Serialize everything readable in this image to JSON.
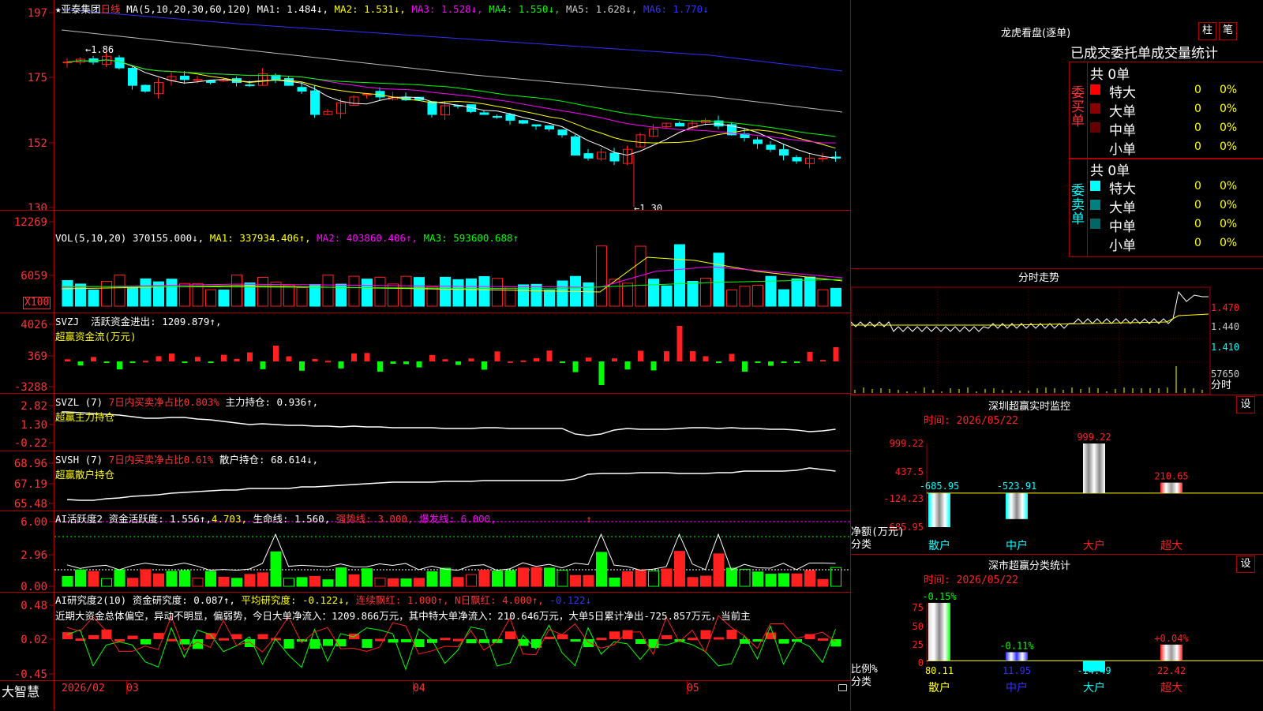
{
  "colors": {
    "up": "#ff2020",
    "down": "#00ffff",
    "bg": "#000000",
    "grid": "#aa0000",
    "yellow": "#ffff00",
    "magenta": "#ff00ff",
    "green": "#00ff00",
    "blue": "#3030ff",
    "white": "#ffffff"
  },
  "main": {
    "header": {
      "star": "★",
      "name": "亚泰集团",
      "period": "日线",
      "ma_label": "MA(5,10,20,30,60,120)",
      "ma1": "MA1: 1.484↓,",
      "ma2": "MA2: 1.531↓,",
      "ma3": "MA3: 1.528↓,",
      "ma4": "MA4: 1.550↓,",
      "ma5": "MA5: 1.628↓,",
      "ma6": "MA6: 1.770↓"
    },
    "yticks": [
      "197",
      "175",
      "152",
      "130"
    ],
    "high_label": "←1.86",
    "low_label": "←1.30"
  },
  "vol": {
    "header": {
      "t1": "VOL(5,10,20)",
      "t2": "370155.000↓,",
      "t3": "MA1: 337934.406↑,",
      "t4": "MA2: 403860.406↑,",
      "t5": "MA3: 593600.688↑"
    },
    "yticks": [
      "12269",
      "6059"
    ],
    "unit": "X100"
  },
  "svzj": {
    "header": {
      "t1": "SVZJ",
      "t2": "活跃资金进出: 1209.879↑,",
      "t3": "超赢资金流(万元)"
    },
    "yticks": [
      "4026",
      "369",
      "-3288"
    ]
  },
  "svzl": {
    "header": {
      "t1": "SVZL (7)",
      "t2": "7日内买卖净占比0.803%",
      "t3": "主力持仓: 0.936↑,",
      "t4": "超赢主力持仓"
    },
    "yticks": [
      "2.82",
      "1.30",
      "-0.22"
    ]
  },
  "svsh": {
    "header": {
      "t1": "SVSH (7)",
      "t2": "7日内买卖净占比0.61%",
      "t3": "散户持仓: 68.614↓,",
      "t4": "超赢散户持仓"
    },
    "yticks": [
      "68.96",
      "67.19",
      "65.48"
    ]
  },
  "ai1": {
    "header": {
      "t1": "AI活跃度2",
      "t2": "资金活跃度: 1.556↑,",
      "t3": "4.703,",
      "t4": "生命线: 1.560,",
      "t5": "强势线: 3.000,",
      "t6": "爆发线: 6.000,",
      "t7": "↑"
    },
    "yticks": [
      "6.00",
      "2.96",
      "0.00"
    ]
  },
  "ai2": {
    "header": {
      "t1": "AI研究度2(10)",
      "t2": "资金研究度: 0.087↑,",
      "t3": "平均研究度: -0.122↓,",
      "t4": "连续飘红: 1.000↑,",
      "t5": "N日飘红: 4.000↑,",
      "t6": "-0.122↓"
    },
    "summary": "近期大资金总体偏空，异动不明显，偏弱势，今日大单净流入：1209.866万元，其中特大单净流入：210.646万元，大单5日累计净出-725.857万元，当前主",
    "yticks": [
      "0.48",
      "0.02",
      "-0.45"
    ]
  },
  "xaxis": {
    "brand": "大智慧",
    "labels": [
      "2026/02",
      "03",
      "04",
      "05"
    ]
  },
  "longhu": {
    "title": "龙虎看盘(逐单)",
    "btn_bar": "柱",
    "btn_pen": "笔",
    "subtitle": "已成交委托单成交量统计",
    "buy": {
      "side": "委买单",
      "total": "共 0单",
      "rows": [
        {
          "label": "特大",
          "value": "0",
          "pct": "0%",
          "color": "#ff0000"
        },
        {
          "label": "大单",
          "value": "0",
          "pct": "0%",
          "color": "#8b0000"
        },
        {
          "label": "中单",
          "value": "0",
          "pct": "0%",
          "color": "#660000"
        },
        {
          "label": "小单",
          "value": "0",
          "pct": "0%",
          "color": "#000000"
        }
      ]
    },
    "sell": {
      "side": "委卖单",
      "total": "共 0单",
      "rows": [
        {
          "label": "特大",
          "value": "0",
          "pct": "0%",
          "color": "#00ffff"
        },
        {
          "label": "大单",
          "value": "0",
          "pct": "0%",
          "color": "#008080"
        },
        {
          "label": "中单",
          "value": "0",
          "pct": "0%",
          "color": "#006666"
        },
        {
          "label": "小单",
          "value": "0",
          "pct": "0%",
          "color": "#000000"
        }
      ]
    }
  },
  "intraday": {
    "title": "分时走势",
    "yticks": [
      "1.470",
      "1.440",
      "1.410",
      "57650"
    ],
    "unit": "分时"
  },
  "monitor": {
    "title": "深圳超赢实时监控",
    "btn": "设",
    "time": "时间: 2026/05/22",
    "yticks": [
      "999.22",
      "437.5",
      "-124.23",
      "-685.95"
    ],
    "ylabel": "净额(万元)",
    "xlabel": "分类",
    "bars": [
      {
        "cat": "散户",
        "value": -685.95,
        "label": "-685.95"
      },
      {
        "cat": "中户",
        "value": -523.91,
        "label": "-523.91"
      },
      {
        "cat": "大户",
        "value": 999.22,
        "label": "999.22"
      },
      {
        "cat": "超大",
        "value": 210.65,
        "label": "210.65"
      }
    ]
  },
  "classify": {
    "title": "深市超赢分类统计",
    "btn": "设",
    "time": "时间: 2026/05/22",
    "yticks": [
      "75",
      "50",
      "25",
      "0"
    ],
    "ylabel": "比例%",
    "xlabel": "分类",
    "bars": [
      {
        "cat": "散户",
        "value": 80.11,
        "label": "80.11",
        "pct": "-0.15%"
      },
      {
        "cat": "中户",
        "value": 11.95,
        "label": "11.95",
        "pct": "-0.11%"
      },
      {
        "cat": "大户",
        "value": -14.49,
        "label": "-14.49",
        "pct": ""
      },
      {
        "cat": "超大",
        "value": 22.42,
        "label": "22.42",
        "pct": "+0.04%"
      }
    ]
  }
}
